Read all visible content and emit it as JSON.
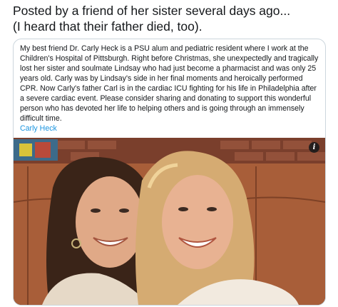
{
  "tweet": {
    "text_line1": "Posted by a friend of her sister several days ago...",
    "text_line2": "(I heard that their father died, too)."
  },
  "card": {
    "paragraph": "My best friend Dr. Carly Heck is a PSU alum and pediatric resident where I work at the Children's Hospital of Pittsburgh. Right before Christmas, she unexpectedly and tragically lost her sister and soulmate Lindsay who had just become a pharmacist and was only 25 years old. Carly was by Lindsay's side in her final moments and heroically performed CPR. Now Carly's father Carl is in the cardiac ICU fighting for his life in Philadelphia after a severe cardiac event. Please consider sharing and donating to support this wonderful person who has devoted her life to helping others and is going through an immensely difficult time.",
    "author": "Carly Heck"
  },
  "photo": {
    "info_icon": "info-icon",
    "info_glyph": "i",
    "colors": {
      "background_wall": "#6b4a33",
      "brick": "#8a4a34",
      "sofa": "#b0663f",
      "left_hair": "#3a2418",
      "right_hair": "#d9b27a",
      "skin": "#e3ad8c"
    }
  },
  "theme": {
    "link_color": "#1b95e0",
    "border_color": "#ccd6dd",
    "text_color": "#14171a"
  }
}
